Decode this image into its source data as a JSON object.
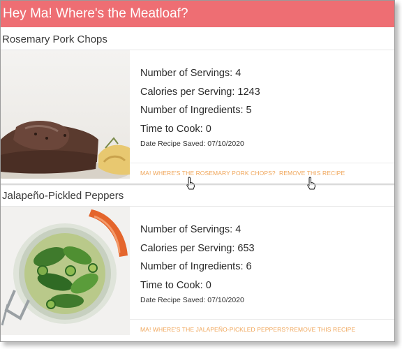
{
  "header": {
    "title": "Hey Ma! Where's the Meatloaf?",
    "color": "#ee6e73"
  },
  "recipes": [
    {
      "name": "Rosemary Pork Chops",
      "image": "pork-chops-photo",
      "servings": "Number of Servings: 4",
      "calories": "Calories per Serving: 1243",
      "ingredients": "Number of Ingredients: 5",
      "time": "Time to Cook: 0",
      "saved": "Date Recipe Saved: 07/10/2020",
      "primary_action": "Ma! Where's the Rosemary Pork Chops?",
      "secondary_action": "Remove this recipe"
    },
    {
      "name": "Jalapeño-Pickled Peppers",
      "image": "pickled-peppers-jar-photo",
      "servings": "Number of Servings: 4",
      "calories": "Calories per Serving: 653",
      "ingredients": "Number of Ingredients: 6",
      "time": "Time to Cook: 0",
      "saved": "Date Recipe Saved: 07/10/2020",
      "primary_action": "Ma! Where's the Jalapeño-Pickled Peppers?",
      "secondary_action": "Remove this recipe"
    }
  ],
  "colors": {
    "link": "#f0a65a",
    "text": "#2a2a2a"
  },
  "icons": [
    "hand-pointer-cursor-icon"
  ]
}
